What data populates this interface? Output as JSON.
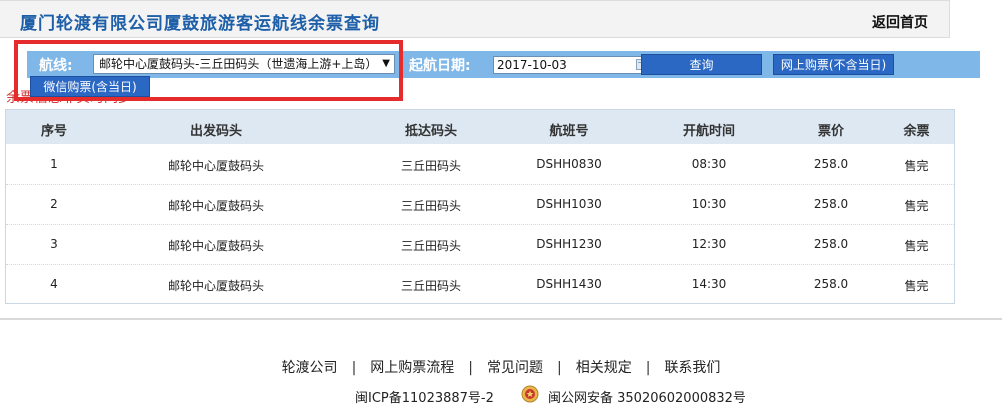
{
  "header": {
    "title": "厦门轮渡有限公司厦鼓旅游客运航线余票查询",
    "home_link": "返回首页"
  },
  "search": {
    "route_label": "航线:",
    "route_value": "邮轮中心厦鼓码头-三丘田码头（世遗海上游+上岛）",
    "date_label": "起航日期:",
    "date_value": "2017-10-03",
    "query_button": "查询",
    "online_button": "网上购票(不含当日)",
    "wechat_button": "微信购票(含当日)"
  },
  "notice": "余票信息非实时同步",
  "table": {
    "headers": [
      "序号",
      "出发码头",
      "抵达码头",
      "航班号",
      "开航时间",
      "票价",
      "余票"
    ],
    "rows": [
      [
        "1",
        "邮轮中心厦鼓码头",
        "三丘田码头",
        "DSHH0830",
        "08:30",
        "258.0",
        "售完"
      ],
      [
        "2",
        "邮轮中心厦鼓码头",
        "三丘田码头",
        "DSHH1030",
        "10:30",
        "258.0",
        "售完"
      ],
      [
        "3",
        "邮轮中心厦鼓码头",
        "三丘田码头",
        "DSHH1230",
        "12:30",
        "258.0",
        "售完"
      ],
      [
        "4",
        "邮轮中心厦鼓码头",
        "三丘田码头",
        "DSHH1430",
        "14:30",
        "258.0",
        "售完"
      ]
    ]
  },
  "footer": {
    "links": [
      "轮渡公司",
      "网上购票流程",
      "常见问题",
      "相关规定",
      "联系我们"
    ],
    "separator": "|",
    "icp": "闽ICP备11023887号-2",
    "police_record": "闽公网安备 35020602000832号",
    "police_icon": "police-badge-icon"
  },
  "colors": {
    "title": "#1d5fa8",
    "searchbar": "#7fb7e8",
    "button": "#2b68c4",
    "table_header": "#dde8f3",
    "highlight": "#e52b2b",
    "notice": "#d23b3b"
  }
}
